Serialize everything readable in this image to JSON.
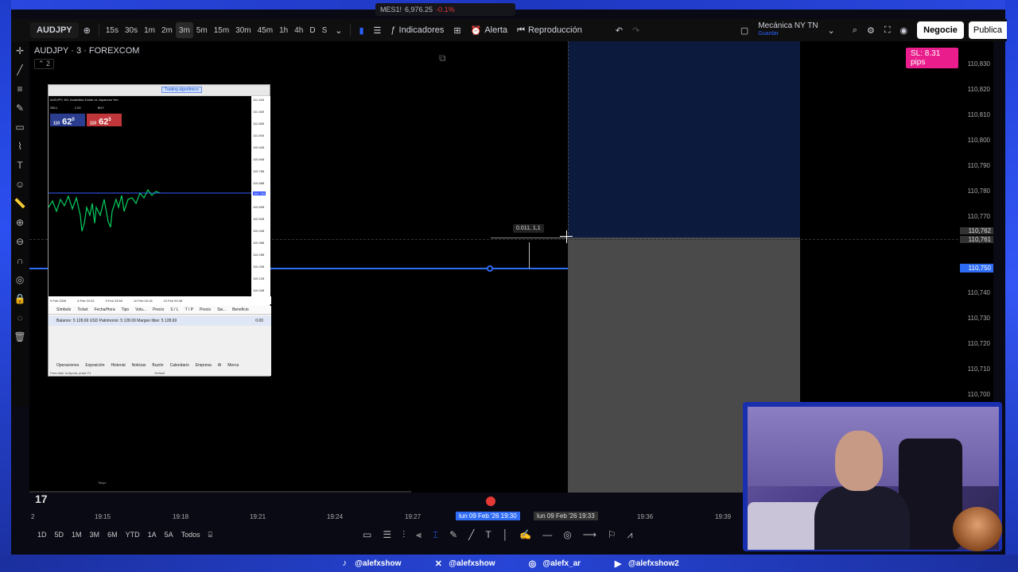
{
  "ticker": {
    "symbol": "MES1!",
    "value": "6,976.25",
    "change": "-0.1%"
  },
  "toolbar": {
    "symbol": "AUDJPY",
    "timeframes": [
      "15s",
      "30s",
      "1m",
      "2m",
      "3m",
      "5m",
      "15m",
      "30m",
      "45m",
      "1h",
      "4h",
      "D",
      "S"
    ],
    "active_timeframe": "3m",
    "indicators_label": "Indicadores",
    "alert_label": "Alerta",
    "replay_label": "Reproducción",
    "layout_name": "Mecánica NY TN",
    "layout_sub": "Guardar",
    "trade_label": "Negocie",
    "publish_label": "Publica"
  },
  "chart": {
    "title": "AUDJPY · 3 · FOREXCOM",
    "indicator_count": "2",
    "sl_badge": "SL: 8.31 pips",
    "measure_label": "0.011, 1,1",
    "price_ticks": [
      "110,830",
      "110,820",
      "110,810",
      "110,800",
      "110,790",
      "110,780",
      "110,770",
      "110,740",
      "110,730",
      "110,720",
      "110,710",
      "110,700"
    ],
    "price_top_label": "110,762",
    "price_mid_label": "110,761",
    "price_current": "110,750",
    "time_ticks": [
      "2",
      "19:15",
      "19:18",
      "19:21",
      "19:24",
      "19:27",
      "19:36",
      "19:39"
    ],
    "time_selected": "lun 09 Feb '26  19:30",
    "time_cursor": "lun 09 Feb '26  19:33"
  },
  "ranges": [
    "1D",
    "5D",
    "1M",
    "3M",
    "6M",
    "YTD",
    "1A",
    "5A",
    "Todos"
  ],
  "mt5": {
    "algo_label": "Trading algorítmico",
    "symbol_line": "AUDJPY, M1: Australian Dollar vs Japanese Yen",
    "sell_label": "SELL",
    "buy_label": "BUY",
    "lot": "1.00",
    "sell_price_small": "110",
    "sell_price": "62",
    "sell_sup": "0",
    "buy_price_small": "110",
    "buy_price": "62",
    "buy_sup": "5",
    "axis": [
      "111.248",
      "111.168",
      "111.088",
      "111.008",
      "110.928",
      "110.848",
      "110.768",
      "110.688",
      "110.608",
      "110.528",
      "110.448",
      "110.368",
      "110.288",
      "110.208",
      "110.128",
      "110.048"
    ],
    "axis_highlight": "110.750",
    "time_labels": [
      "9 Feb 2026",
      "6 Feb 22:42",
      "9 Feb 23:50",
      "10 Feb 00:18",
      "10 Feb 00:48"
    ],
    "columns": [
      "Símbolo",
      "Ticket",
      "Fecha/Hora",
      "Tipo",
      "Volu...",
      "Precio",
      "S / L",
      "T / P",
      "Precio",
      "Sw...",
      "Beneficio"
    ],
    "balance": "Balance: 5 128.69 USD  Patrimonio: 5 128.69  Margen libre: 5 128.69",
    "balance_value": "0.00",
    "tabs": [
      "Operaciones",
      "Exposición",
      "Historial",
      "Noticias",
      "Buzón",
      "Calendario",
      "Empresa",
      "Al",
      "Merca"
    ],
    "help": "Para abrir la Ayuda, pulse F1",
    "help_right": "Default",
    "tokyo": "Tokyo"
  },
  "footer": {
    "tiktok": "@alefxshow",
    "x": "@alefxshow",
    "instagram": "@alefx_ar",
    "youtube": "@alefxshow2"
  }
}
